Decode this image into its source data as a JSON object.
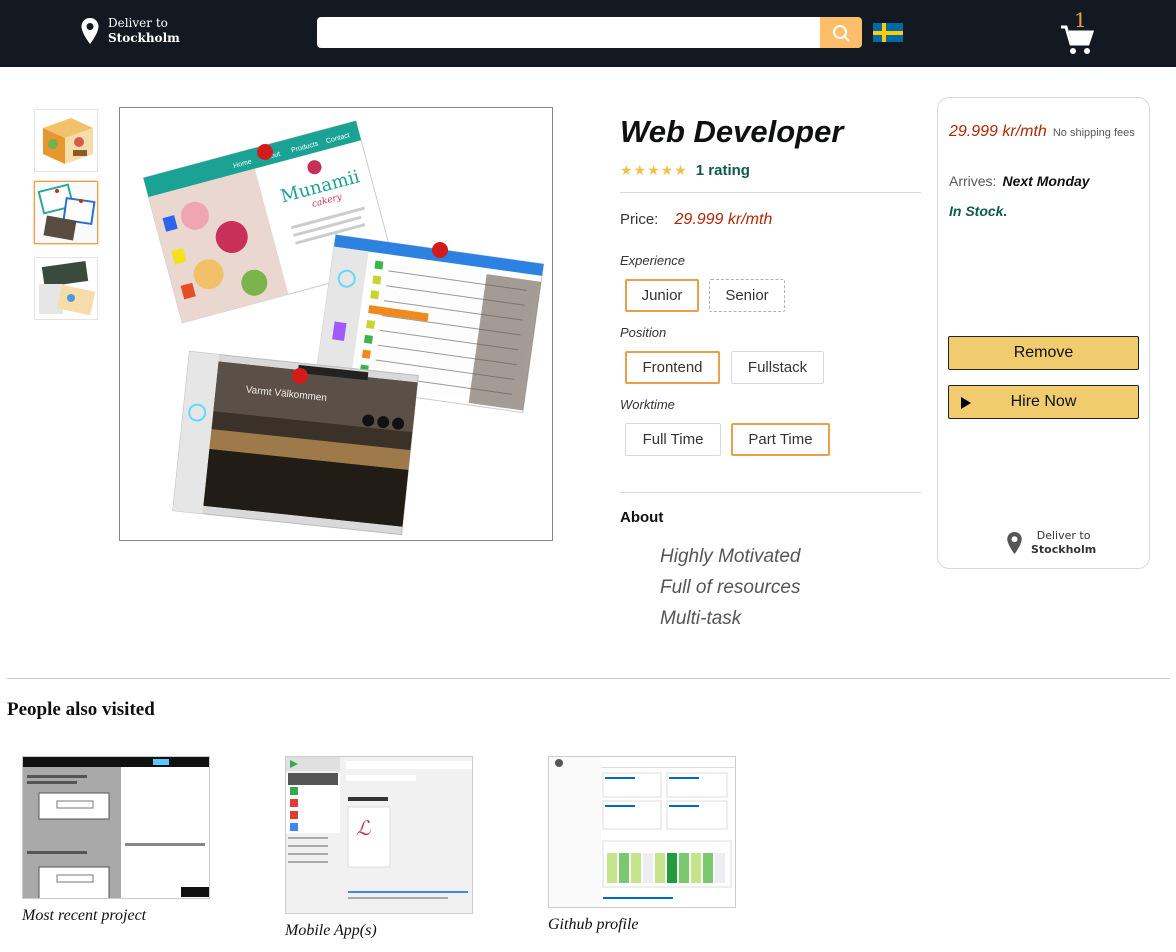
{
  "header": {
    "deliver_line1": "Deliver to",
    "deliver_line2": "Stockholm",
    "search_placeholder": "",
    "cart_count": "1",
    "flag": "sweden-flag"
  },
  "product": {
    "title": "Web Developer",
    "stars": "★★★★★",
    "rating_text": "1 rating",
    "price_label": "Price:",
    "price_value": "29.999 kr/mth",
    "options": {
      "experience": {
        "label": "Experience",
        "choices": [
          "Junior",
          "Senior"
        ],
        "selected": "Junior"
      },
      "position": {
        "label": "Position",
        "choices": [
          "Frontend",
          "Fullstack"
        ],
        "selected": "Frontend"
      },
      "worktime": {
        "label": "Worktime",
        "choices": [
          "Full Time",
          "Part Time"
        ],
        "selected": "Part Time"
      }
    },
    "about_title": "About",
    "about_items": [
      "Highly Motivated",
      "Full of resources",
      "Multi-task"
    ]
  },
  "buybox": {
    "price": "29.999 kr/mth",
    "shipping": "No shipping fees",
    "arrives_label": "Arrives:",
    "arrives_value": "Next Monday",
    "stock": "In Stock.",
    "remove_label": "Remove",
    "hire_label": "Hire Now",
    "deliver_line1": "Deliver to",
    "deliver_line2": "Stockholm"
  },
  "also_visited": {
    "title": "People also visited",
    "cards": [
      {
        "caption": "Most recent project"
      },
      {
        "caption": "Mobile App(s)"
      },
      {
        "caption": "Github profile"
      }
    ]
  },
  "gallery": {
    "munamii_title": "Munamii",
    "munamii_sub": "cakery",
    "nav_items": [
      "Home",
      "About",
      "Products",
      "Contact"
    ],
    "portfolio_title": "Varmt Välkommen"
  },
  "colors": {
    "topbar": "#131921",
    "search_button": "#febd69",
    "accent_border": "#e8a04a",
    "price": "#b12704",
    "in_stock": "#0b5c4a",
    "button_fill": "#f0cc6e"
  }
}
